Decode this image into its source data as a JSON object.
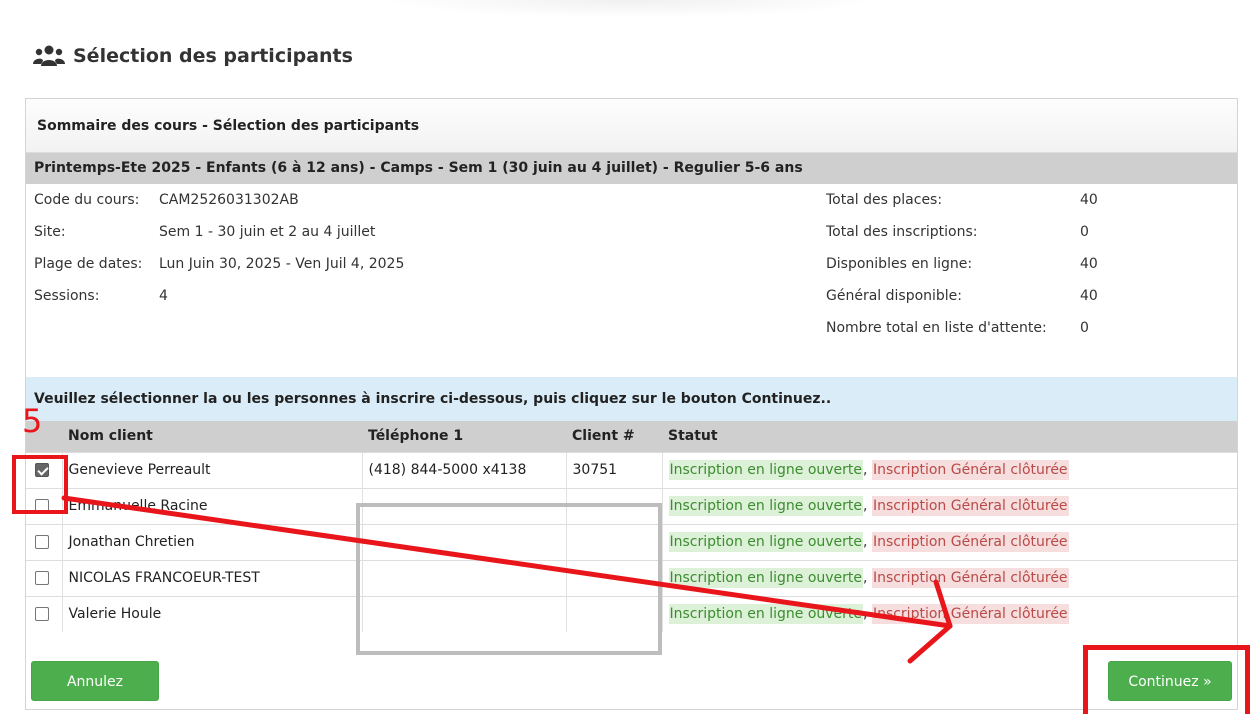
{
  "header": {
    "title": "Sélection des participants",
    "icon": "users-icon"
  },
  "panel": {
    "title": "Sommaire des cours - Sélection des participants",
    "course_name": "Printemps-Ete 2025 - Enfants (6 à 12 ans) - Camps - Sem 1 (30 juin au 4 juillet) - Regulier 5-6 ans"
  },
  "details_left": [
    {
      "label": "Code du cours:",
      "value": "CAM2526031302AB"
    },
    {
      "label": "Site:",
      "value": "Sem 1 - 30 juin et 2 au 4 juillet"
    },
    {
      "label": "Plage de dates:",
      "value": "Lun  Juin 30, 2025 - Ven  Juil 4, 2025"
    },
    {
      "label": "Sessions:",
      "value": "4"
    }
  ],
  "details_right": [
    {
      "label": "Total des places:",
      "value": "40"
    },
    {
      "label": "Total des inscriptions:",
      "value": "0"
    },
    {
      "label": "Disponibles en ligne:",
      "value": "40"
    },
    {
      "label": "Général disponible:",
      "value": "40"
    },
    {
      "label": "Nombre total en liste d'attente:",
      "value": "0"
    }
  ],
  "instruction": "Veuillez sélectionner la ou les personnes à inscrire ci-dessous, puis cliquez sur le bouton Continuez..",
  "table": {
    "headers": {
      "name": "Nom client",
      "phone": "Téléphone 1",
      "client": "Client #",
      "status": "Statut"
    },
    "rows": [
      {
        "name": "Genevieve Perreault",
        "phone": "(418) 844-5000 x4138",
        "client": "30751",
        "checked": true
      },
      {
        "name": "Emmanuelle Racine",
        "phone": "",
        "client": "",
        "checked": false
      },
      {
        "name": "Jonathan Chretien",
        "phone": "",
        "client": "",
        "checked": false
      },
      {
        "name": "NICOLAS FRANCOEUR-TEST",
        "phone": "",
        "client": "",
        "checked": false
      },
      {
        "name": "Valerie Houle",
        "phone": "",
        "client": "",
        "checked": false
      }
    ],
    "status_open": "Inscription en ligne ouverte",
    "status_sep": ",",
    "status_closed": "Inscription Général clôturée"
  },
  "buttons": {
    "cancel": "Annulez",
    "continue": "Continuez »"
  },
  "annotations": {
    "step_number": "5",
    "color": "#e8161b"
  },
  "colors": {
    "success": "#4cae4c",
    "info_bg": "#d9ecf7",
    "header_bg": "#cfcfcf"
  }
}
